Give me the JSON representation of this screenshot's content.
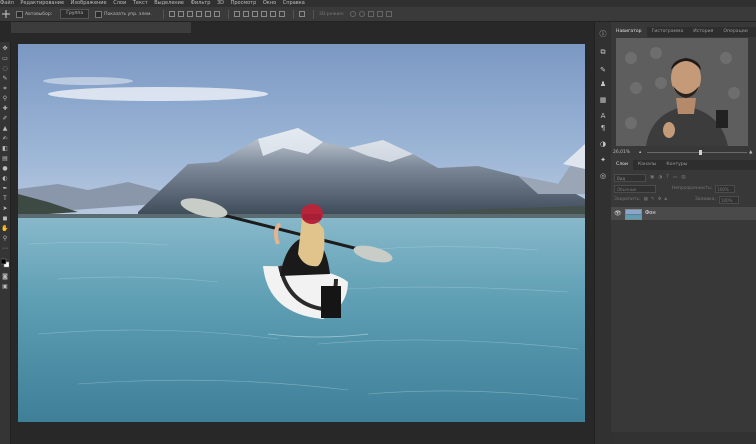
{
  "menubar": {
    "items": [
      "Файл",
      "Редактирование",
      "Изображение",
      "Слои",
      "Текст",
      "Выделение",
      "Фильтр",
      "3D",
      "Просмотр",
      "Окно",
      "Справка"
    ]
  },
  "options": {
    "autoselect_label": "Автовыбор:",
    "autoselect_value": "Группа",
    "transform_label": "Показать упр. элем.",
    "mode3d_label": "3D-режим:"
  },
  "document": {
    "tab_label": ""
  },
  "navigator": {
    "tabs": [
      "Навигатор",
      "Гистограмма",
      "История",
      "Операции"
    ],
    "active_tab": 0,
    "zoom": "26,01%"
  },
  "layers": {
    "tabs": [
      "Слои",
      "Каналы",
      "Контуры"
    ],
    "active_tab": 0,
    "kind_label": "Вид",
    "blend_mode": "Обычные",
    "opacity_label": "Непрозрачность:",
    "opacity_value": "100%",
    "lock_label": "Закрепить:",
    "fill_label": "Заливка:",
    "fill_value": "100%",
    "items": [
      {
        "name": "Фон"
      }
    ]
  },
  "icons": {
    "visibility": "eye-icon",
    "move": "move-icon"
  },
  "colors": {
    "ui_dark": "#282828",
    "panel": "#383838",
    "sky_top": "#7e9bc6",
    "water": "#5fa0b4",
    "helmet": "#c4243a"
  }
}
